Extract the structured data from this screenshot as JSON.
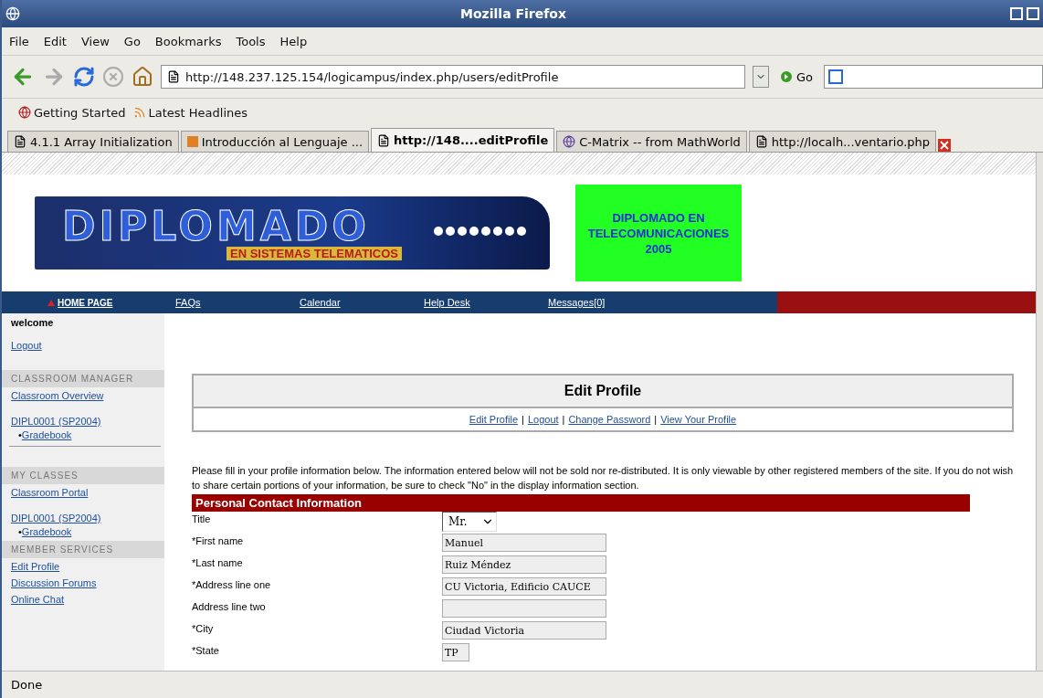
{
  "window": {
    "title": "Mozilla Firefox"
  },
  "menu": [
    "File",
    "Edit",
    "View",
    "Go",
    "Bookmarks",
    "Tools",
    "Help"
  ],
  "toolbar": {
    "address": "http://148.237.125.154/logicampus/index.php/users/editProfile",
    "go_label": "Go"
  },
  "bookmarks": [
    "Getting Started",
    "Latest Headlines"
  ],
  "tabs": [
    {
      "label": "4.1.1 Array Initialization",
      "selected": false,
      "kind": "page"
    },
    {
      "label": "Introducción al Lenguaje ...",
      "selected": false,
      "kind": "orange"
    },
    {
      "label": "http://148....editProfile",
      "selected": true,
      "kind": "page"
    },
    {
      "label": "C-Matrix -- from MathWorld",
      "selected": false,
      "kind": "globe"
    },
    {
      "label": "http://localh...ventario.php",
      "selected": false,
      "kind": "page"
    }
  ],
  "header": {
    "logo_title": "DIPLOMADO",
    "logo_subtitle": "EN SISTEMAS TELEMATICOS",
    "promo_lines": [
      "DIPLOMADO EN",
      "TELECOMUNICACIONES",
      "2005"
    ]
  },
  "nav": [
    {
      "label": "HOME PAGE",
      "selected": true
    },
    {
      "label": "FAQs",
      "selected": false
    },
    {
      "label": "Calendar",
      "selected": false
    },
    {
      "label": "Help Desk",
      "selected": false
    },
    {
      "label": "Messages[0]",
      "selected": false
    }
  ],
  "sidebar": {
    "welcome": "welcome",
    "logout": "Logout",
    "sections": [
      {
        "heading": "CLASSROOM MANAGER",
        "items": [
          {
            "label": "Classroom Overview"
          },
          {
            "label": "DIPL0001 (SP2004)",
            "children": [
              {
                "bullet": "•",
                "label": "Gradebook"
              }
            ]
          }
        ]
      },
      {
        "heading": "MY CLASSES",
        "items": [
          {
            "label": "Classroom Portal"
          },
          {
            "label": "DIPL0001 (SP2004)",
            "children": [
              {
                "bullet": "•",
                "label": "Gradebook"
              }
            ]
          }
        ]
      },
      {
        "heading": "MEMBER SERVICES",
        "items": [
          {
            "label": "Edit Profile"
          },
          {
            "label": "Discussion Forums"
          },
          {
            "label": "Online Chat"
          }
        ]
      }
    ]
  },
  "main": {
    "title": "Edit Profile",
    "links": [
      {
        "label": "Edit Profile",
        "separator": "|"
      },
      {
        "label": "Logout",
        "separator": "|"
      },
      {
        "label": "Change Password",
        "separator": "|"
      },
      {
        "label": "View Your Profile"
      }
    ],
    "intro": "Please fill in your profile information below. The information entered below will not be sold nor re-distributed. It is only viewable by other registered members of the site. If you do not wish to share certain portions of your information, be sure to check \"No\" in the display information section.",
    "section": "Personal Contact Information",
    "fields": [
      {
        "label": "Title",
        "kind": "select",
        "value": "Mr."
      },
      {
        "label": "*First name",
        "kind": "text",
        "value": "Manuel"
      },
      {
        "label": "*Last name",
        "kind": "text",
        "value": "Ruiz Méndez"
      },
      {
        "label": "*Address line one",
        "kind": "text",
        "value": "CU Victoria, Edificio CAUCE"
      },
      {
        "label": "Address line two",
        "kind": "text"
      },
      {
        "label": "*City",
        "kind": "text",
        "value": "Ciudad Victoria"
      },
      {
        "label": "*State",
        "kind": "short",
        "value": "TP"
      }
    ]
  },
  "status_bar": "Done"
}
